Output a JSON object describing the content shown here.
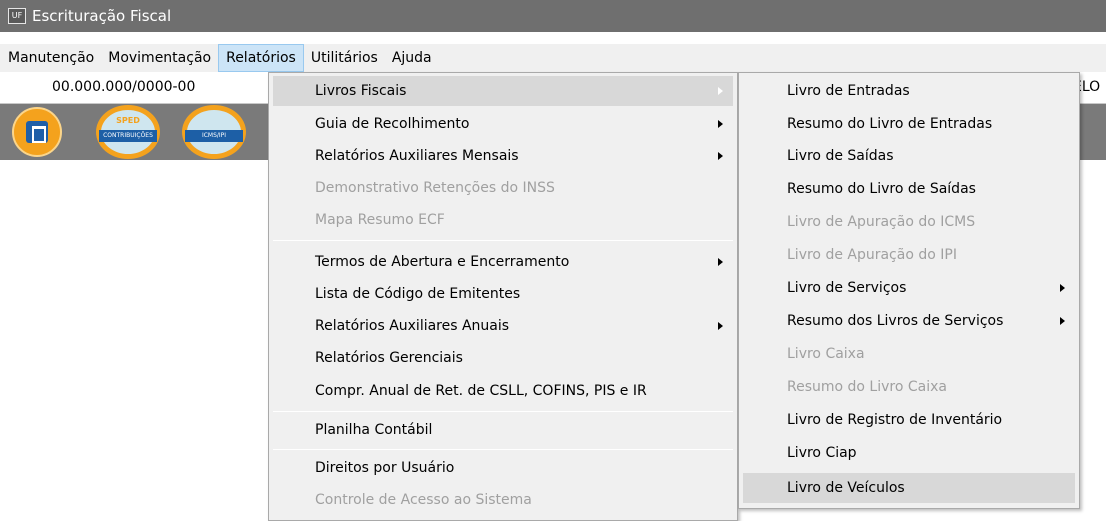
{
  "window": {
    "title": "Escrituração Fiscal",
    "icon": "app-icon-uf",
    "icon_text": "UF"
  },
  "menubar": {
    "items": [
      {
        "label": "Manutenção"
      },
      {
        "label": "Movimentação"
      },
      {
        "label": "Relatórios"
      },
      {
        "label": "Utilitários"
      },
      {
        "label": "Ajuda"
      }
    ],
    "active": "Relatórios"
  },
  "company": {
    "cnpj": "00.000.000/0000-00",
    "right_text": "ELO"
  },
  "toolbar": {
    "buttons": [
      {
        "name": "building-icon"
      },
      {
        "name": "sped-contribuicoes-icon",
        "top_text": "SPED",
        "band_text": "CONTRIBUIÇÕES"
      },
      {
        "name": "icms-ipi-icon",
        "band_text": "ICMS/IPI"
      }
    ],
    "accent": "#f4a21d"
  },
  "relatorios_menu": {
    "items": [
      {
        "label": "Livros Fiscais",
        "submenu": true,
        "highlighted": true
      },
      {
        "label": "Guia de Recolhimento",
        "submenu": true
      },
      {
        "label": "Relatórios Auxiliares Mensais",
        "submenu": true
      },
      {
        "label": "Demonstrativo Retenções do INSS",
        "disabled": true
      },
      {
        "label": "Mapa Resumo ECF",
        "disabled": true
      },
      {
        "label": "Termos de Abertura e Encerramento",
        "submenu": true
      },
      {
        "label": "Lista de Código de Emitentes"
      },
      {
        "label": "Relatórios Auxiliares Anuais",
        "submenu": true
      },
      {
        "label": "Relatórios Gerenciais"
      },
      {
        "label": "Compr. Anual de Ret. de CSLL, COFINS,  PIS e IR"
      },
      {
        "label": "Planilha Contábil"
      },
      {
        "label": "Direitos por Usuário"
      },
      {
        "label": "Controle de Acesso ao Sistema",
        "disabled": true
      }
    ]
  },
  "livros_fiscais_menu": {
    "items": [
      {
        "label": "Livro de Entradas"
      },
      {
        "label": "Resumo do Livro de Entradas"
      },
      {
        "label": "Livro de Saídas"
      },
      {
        "label": "Resumo do Livro de Saídas"
      },
      {
        "label": "Livro de Apuração do ICMS",
        "disabled": true
      },
      {
        "label": "Livro de Apuração do IPI",
        "disabled": true
      },
      {
        "label": "Livro de Serviços",
        "submenu": true
      },
      {
        "label": "Resumo dos Livros de Serviços",
        "submenu": true
      },
      {
        "label": "Livro Caixa",
        "disabled": true
      },
      {
        "label": "Resumo do Livro Caixa",
        "disabled": true
      },
      {
        "label": "Livro de Registro de Inventário"
      },
      {
        "label": "Livro Ciap"
      },
      {
        "label": "Livro de Veículos",
        "highlighted": true
      }
    ]
  }
}
